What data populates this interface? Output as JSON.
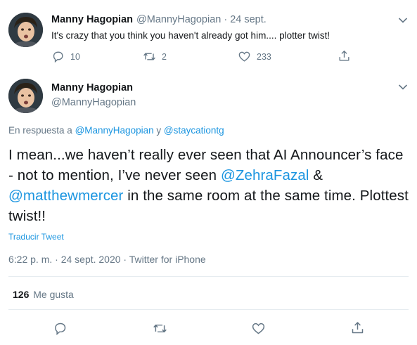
{
  "colors": {
    "accent": "#1b95e0",
    "muted": "#657786",
    "text": "#14171a",
    "divider": "#e6ecf0"
  },
  "parent_tweet": {
    "name": "Manny Hagopian",
    "handle": "@MannyHagopian",
    "dot": "·",
    "date": "24 sept.",
    "text": "It's crazy that you think you haven't already got him.... plotter twist!",
    "replies": "10",
    "retweets": "2",
    "likes": "233"
  },
  "main_tweet": {
    "name": "Manny Hagopian",
    "handle": "@MannyHagopian",
    "reply_prefix": "En respuesta a",
    "reply_user1": "@MannyHagopian",
    "reply_and": "y",
    "reply_user2": "@staycationtg",
    "text_part1": "I mean...we haven’t really ever seen that AI Announcer’s face - not to mention, I’ve never seen ",
    "mention1": "@ZehraFazal",
    "text_part2": " & ",
    "mention2": "@matthewmercer",
    "text_part3": " in the same room at the same time. Plottest twist!!",
    "translate": "Traducir Tweet",
    "timestamp": "6:22 p. m. · 24 sept. 2020 · Twitter for iPhone",
    "likes_count": "126",
    "likes_label": "Me gusta"
  },
  "icons": [
    "reply-icon",
    "retweet-icon",
    "like-icon",
    "share-icon",
    "chevron-down-icon"
  ]
}
